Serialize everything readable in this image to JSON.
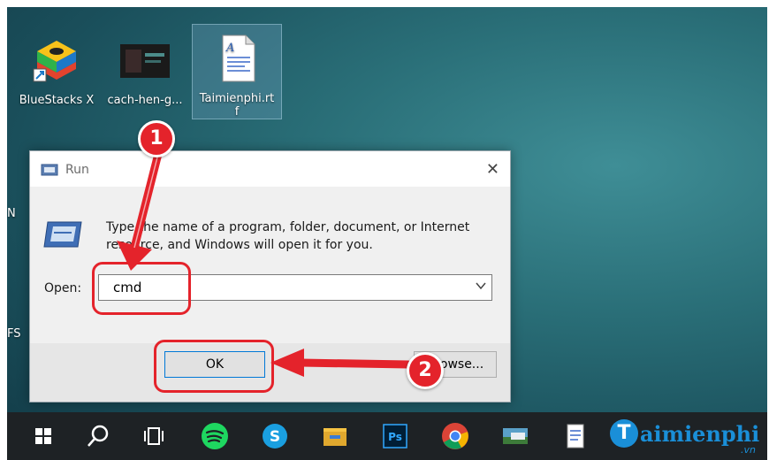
{
  "desktop": {
    "icons": [
      {
        "label": "BlueStacks X"
      },
      {
        "label": "cach-hen-g..."
      },
      {
        "label": "Taimienphi.rt f"
      }
    ],
    "fragments": [
      "N",
      "FS"
    ]
  },
  "run_dialog": {
    "title": "Run",
    "close_glyph": "✕",
    "description": "Type the name of a program, folder, document, or Internet resource, and Windows will open it for you.",
    "open_label": "Open:",
    "open_value": "cmd",
    "ok_label": "OK",
    "browse_label": "Browse..."
  },
  "annotations": {
    "step1": "1",
    "step2": "2",
    "color": "#e4232b"
  },
  "taskbar": {
    "items": [
      "windows-start-icon",
      "search-icon",
      "task-view-icon",
      "spotify-icon",
      "skype-icon",
      "file-explorer-icon",
      "photoshop-icon",
      "chrome-icon",
      "ftp-icon",
      "document-icon"
    ],
    "photoshop_text": "Ps"
  },
  "watermark": {
    "circle": "T",
    "text": "aimienphi",
    "suffix": ".vn"
  }
}
